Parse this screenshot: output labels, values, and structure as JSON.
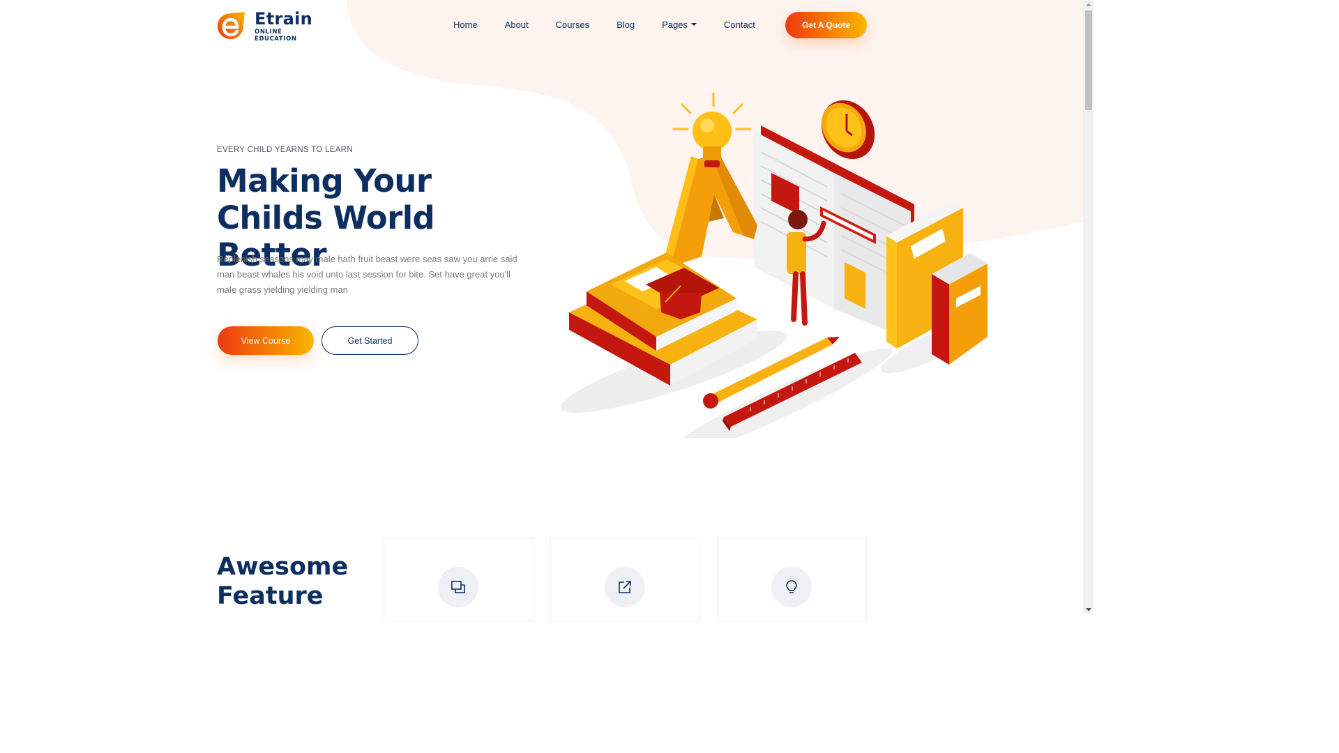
{
  "brand": {
    "name": "Etrain",
    "tagline": "ONLINE EDUCATION",
    "colors": {
      "primary_dark": "#0c2e60",
      "gradient_start": "#ee390f",
      "gradient_end": "#f9b700",
      "blob": "#fdf4f0"
    }
  },
  "nav": {
    "items": [
      {
        "label": "Home"
      },
      {
        "label": "About"
      },
      {
        "label": "Courses"
      },
      {
        "label": "Blog"
      },
      {
        "label": "Pages",
        "dropdown": true
      },
      {
        "label": "Contact"
      }
    ],
    "cta_label": "Get A Quote"
  },
  "hero": {
    "eyebrow": "EVERY CHILD YEARNS TO LEARN",
    "title": "Making Your Childs World Better",
    "description": "Replenish seasons may male hath fruit beast were seas saw you arrie said man beast whales his void unto last session for bite. Set have great you'll male grass yielding yielding man",
    "primary_button": "View Course",
    "secondary_button": "Get Started"
  },
  "features": {
    "title": "Awesome Feature",
    "cards": [
      {
        "icon": "layers-icon"
      },
      {
        "icon": "external-link-icon"
      },
      {
        "icon": "lightbulb-icon"
      }
    ]
  }
}
